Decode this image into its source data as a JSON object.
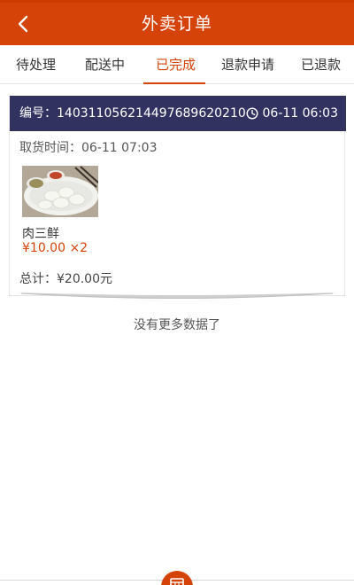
{
  "header": {
    "title": "外卖订单",
    "back_icon": "chevron-left-icon",
    "bg_color": "#d54308"
  },
  "tabs": [
    {
      "label": "待处理",
      "active": false
    },
    {
      "label": "配送中",
      "active": false
    },
    {
      "label": "已完成",
      "active": true
    },
    {
      "label": "退款申请",
      "active": false
    },
    {
      "label": "已退款",
      "active": false
    }
  ],
  "order": {
    "number_label": "编号：",
    "number": "1403110562144976896202​10",
    "time": "06-11 06:03",
    "clock_icon": "clock-icon",
    "pickup_label": "取货时间：",
    "pickup_time": "06-11 07:03",
    "item": {
      "name": "肉三鲜",
      "price": "¥10.00",
      "quantity": "×2",
      "image_icon": "dumplings-image"
    },
    "total_label": "总计：",
    "total": "¥20.00元"
  },
  "footer": {
    "no_more_text": "没有更多数据了",
    "fab_icon": "store-icon"
  },
  "colors": {
    "accent": "#d54308",
    "card_header": "#323260"
  }
}
